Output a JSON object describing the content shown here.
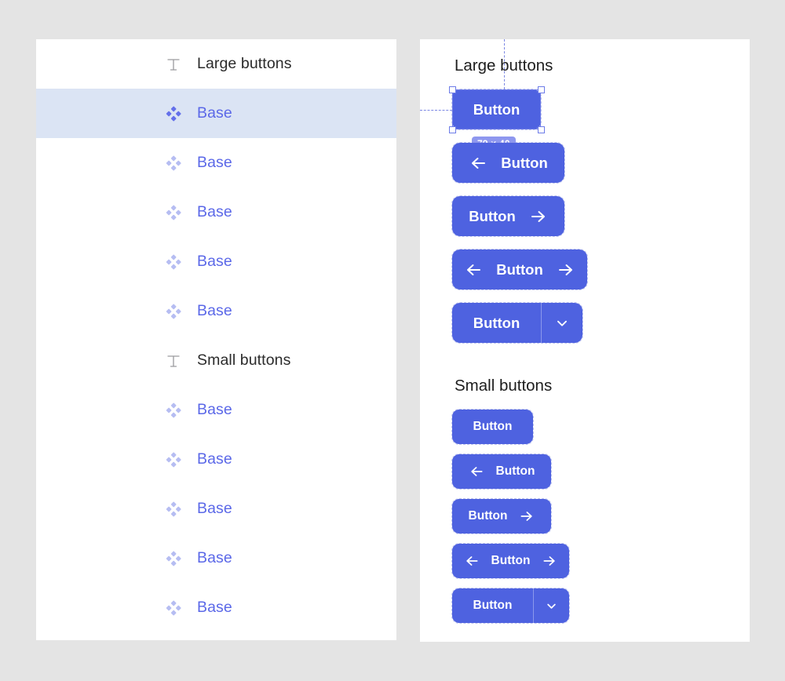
{
  "canvas_background": "#e4e4e4",
  "accent_color": "#4e62e0",
  "selection_color": "#6d7ce8",
  "component_text_color": "#5b68e8",
  "selected_row_background": "#dbe4f4",
  "layers_panel": {
    "rows": [
      {
        "label": "Large buttons",
        "icon": "text-icon",
        "kind": "text",
        "selected": false
      },
      {
        "label": "Base",
        "icon": "component-icon",
        "kind": "component",
        "selected": true
      },
      {
        "label": "Base",
        "icon": "component-icon",
        "kind": "component",
        "selected": false
      },
      {
        "label": "Base",
        "icon": "component-icon",
        "kind": "component",
        "selected": false
      },
      {
        "label": "Base",
        "icon": "component-icon",
        "kind": "component",
        "selected": false
      },
      {
        "label": "Base",
        "icon": "component-icon",
        "kind": "component",
        "selected": false
      },
      {
        "label": "Small buttons",
        "icon": "text-icon",
        "kind": "text",
        "selected": false
      },
      {
        "label": "Base",
        "icon": "component-icon",
        "kind": "component",
        "selected": false
      },
      {
        "label": "Base",
        "icon": "component-icon",
        "kind": "component",
        "selected": false
      },
      {
        "label": "Base",
        "icon": "component-icon",
        "kind": "component",
        "selected": false
      },
      {
        "label": "Base",
        "icon": "component-icon",
        "kind": "component",
        "selected": false
      },
      {
        "label": "Base",
        "icon": "component-icon",
        "kind": "component",
        "selected": false
      }
    ]
  },
  "canvas": {
    "sections": {
      "large_title": "Large buttons",
      "small_title": "Small buttons"
    },
    "selection": {
      "size_badge": "79 × 40"
    },
    "large_buttons": [
      {
        "label": "Button",
        "leading_icon": null,
        "trailing_icon": null,
        "selected": true
      },
      {
        "label": "Button",
        "leading_icon": "arrow-left-icon",
        "trailing_icon": null,
        "selected": false
      },
      {
        "label": "Button",
        "leading_icon": null,
        "trailing_icon": "arrow-right-icon",
        "selected": false
      },
      {
        "label": "Button",
        "leading_icon": "arrow-left-icon",
        "trailing_icon": "arrow-right-icon",
        "selected": false
      },
      {
        "label": "Button",
        "leading_icon": null,
        "trailing_icon": "chevron-down-icon",
        "selected": false,
        "split": true
      }
    ],
    "small_buttons": [
      {
        "label": "Button",
        "leading_icon": null,
        "trailing_icon": null,
        "selected": false
      },
      {
        "label": "Button",
        "leading_icon": "arrow-left-icon",
        "trailing_icon": null,
        "selected": false
      },
      {
        "label": "Button",
        "leading_icon": null,
        "trailing_icon": "arrow-right-icon",
        "selected": false
      },
      {
        "label": "Button",
        "leading_icon": "arrow-left-icon",
        "trailing_icon": "arrow-right-icon",
        "selected": false
      },
      {
        "label": "Button",
        "leading_icon": null,
        "trailing_icon": "chevron-down-icon",
        "selected": false,
        "split": true
      }
    ]
  }
}
